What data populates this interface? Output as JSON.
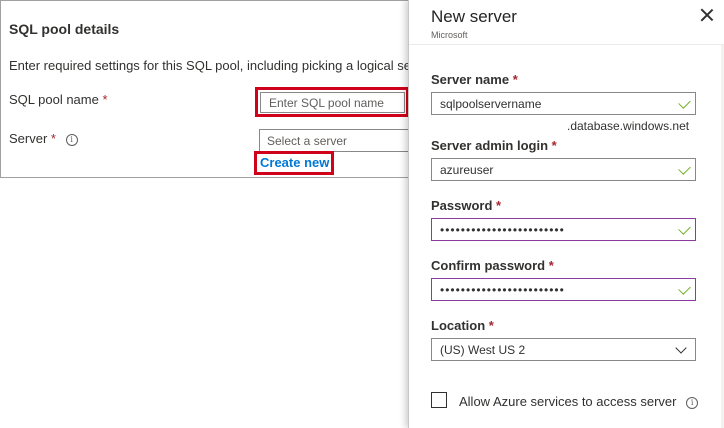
{
  "left_panel": {
    "section_title": "SQL pool details",
    "intro": "Enter required settings for this SQL pool, including picking a logical server",
    "pool_name_label": "SQL pool name",
    "pool_name_placeholder": "Enter SQL pool name",
    "server_label": "Server",
    "server_placeholder": "Select a server",
    "create_new": "Create new",
    "required_mark": "*",
    "info_glyph": "i"
  },
  "blade": {
    "title": "New server",
    "subtitle": "Microsoft",
    "server_name_label": "Server name",
    "server_name_value": "sqlpoolservername",
    "server_name_suffix": ".database.windows.net",
    "admin_login_label": "Server admin login",
    "admin_login_value": "azureuser",
    "password_label": "Password",
    "password_value": "••••••••••••••••••••••••",
    "confirm_label": "Confirm password",
    "confirm_value": "••••••••••••••••••••••••",
    "location_label": "Location",
    "location_value": "(US) West US 2",
    "allow_azure_label": "Allow Azure services to access server",
    "required_mark": "*",
    "info_glyph": "i"
  },
  "colors": {
    "highlight": "#d0021b",
    "link": "#0078d4",
    "required": "#a4262c",
    "valid_check": "#57a300",
    "focus_border": "#8a3b9c"
  },
  "icons": [
    "info-icon",
    "close-icon",
    "check-icon",
    "chevron-down-icon"
  ]
}
